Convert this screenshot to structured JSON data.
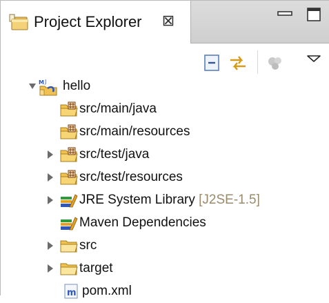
{
  "view": {
    "title": "Project Explorer",
    "close_glyph": "⊠"
  },
  "toolbar": {
    "buttons": [
      {
        "name": "collapse-all-icon"
      },
      {
        "name": "link-with-editor-icon"
      },
      {
        "name": "focus-on-active-task-icon"
      },
      {
        "name": "view-menu-icon"
      }
    ]
  },
  "tree": {
    "project": {
      "label": "hello",
      "expanded": true,
      "icon": "maven-project-icon"
    },
    "items": [
      {
        "label": "src/main/java",
        "icon": "source-folder-icon",
        "expandable": false
      },
      {
        "label": "src/main/resources",
        "icon": "source-folder-icon",
        "expandable": false
      },
      {
        "label": "src/test/java",
        "icon": "source-folder-icon",
        "expandable": true
      },
      {
        "label": "src/test/resources",
        "icon": "source-folder-icon",
        "expandable": true
      },
      {
        "label": "JRE System Library",
        "decoration": "[J2SE-1.5]",
        "icon": "library-icon",
        "expandable": true
      },
      {
        "label": "Maven Dependencies",
        "icon": "library-icon",
        "expandable": false
      },
      {
        "label": "src",
        "icon": "folder-icon",
        "expandable": true
      },
      {
        "label": "target",
        "icon": "folder-icon",
        "expandable": true
      },
      {
        "label": "pom.xml",
        "icon": "maven-pom-icon",
        "expandable": false
      }
    ]
  },
  "colors": {
    "folder": "#e8b23a",
    "package_mark": "#7a3b12",
    "library_green": "#2e9a3a",
    "library_orange": "#e5a020",
    "library_blue": "#2f57b8",
    "decoration": "#9a8a6a"
  }
}
